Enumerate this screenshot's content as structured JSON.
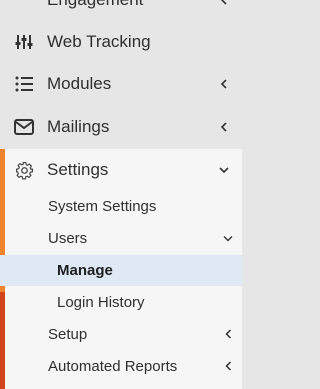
{
  "menu": {
    "items": [
      {
        "label": "Engagement",
        "icon": "engagement-icon"
      },
      {
        "label": "Web Tracking",
        "icon": "sliders-icon"
      },
      {
        "label": "Modules",
        "icon": "list-icon"
      },
      {
        "label": "Mailings",
        "icon": "envelope-icon"
      },
      {
        "label": "Settings",
        "icon": "gear-icon"
      }
    ],
    "settings_sub": {
      "system_settings": "System Settings",
      "users": "Users",
      "manage": "Manage",
      "login_history": "Login History",
      "setup": "Setup",
      "automated_reports": "Automated Reports"
    }
  },
  "colors": {
    "accent_orange": "#f0842c",
    "accent_red": "#d1451c",
    "active_bg": "#dfe9f6",
    "sidebar_bg": "#e6e6e6",
    "panel_bg": "#f6f6f6"
  }
}
